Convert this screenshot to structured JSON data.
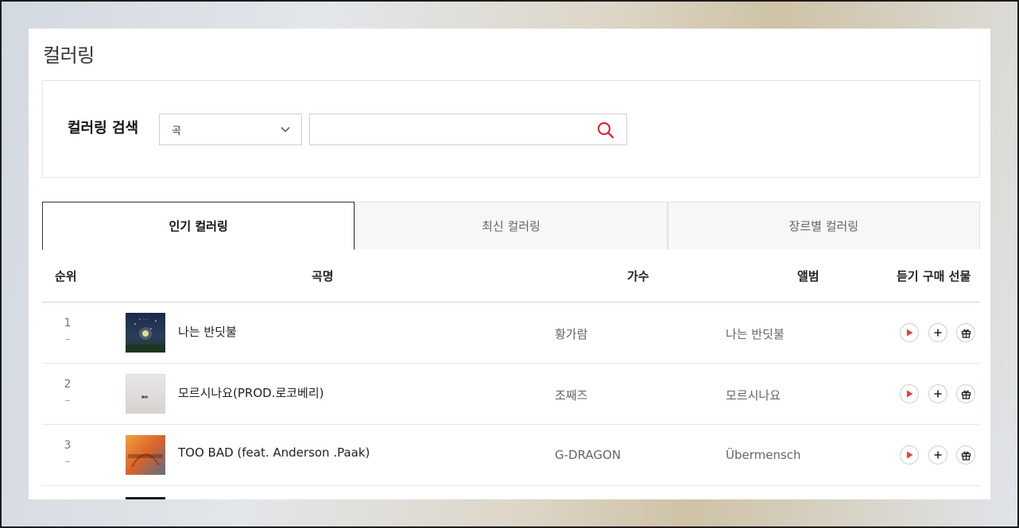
{
  "page_title": "컬러링",
  "search": {
    "label": "컬러링 검색",
    "select_value": "곡",
    "input_value": "",
    "input_placeholder": "",
    "accent_color": "#e0162b"
  },
  "tabs": [
    {
      "label": "인기 컬러링",
      "active": true
    },
    {
      "label": "최신 컬러링",
      "active": false
    },
    {
      "label": "장르별 컬러링",
      "active": false
    }
  ],
  "table": {
    "headers": {
      "rank": "순위",
      "title": "곡명",
      "artist": "가수",
      "album": "앨범",
      "actions": "듣기 구매 선물"
    },
    "rows": [
      {
        "rank": "1",
        "change": "–",
        "title": "나는 반딧불",
        "artist": "황가람",
        "album": "나는 반딧불",
        "thumb_icon": "album-art-night-sky"
      },
      {
        "rank": "2",
        "change": "–",
        "title": "모르시나요(PROD.로코베리)",
        "artist": "조째즈",
        "album": "모르시나요",
        "thumb_icon": "album-art-snowy-field"
      },
      {
        "rank": "3",
        "change": "–",
        "title": "TOO BAD (feat. Anderson .Paak)",
        "artist": "G-DRAGON",
        "album": "Übermensch",
        "thumb_icon": "album-art-ubermensch"
      }
    ]
  },
  "icons": {
    "select_arrow": "chevron-down-icon",
    "search": "search-icon",
    "play": "play-icon",
    "add": "plus-icon",
    "gift": "gift-icon"
  },
  "colors": {
    "play_red": "#e8413a",
    "active_tab_border": "#333333"
  }
}
